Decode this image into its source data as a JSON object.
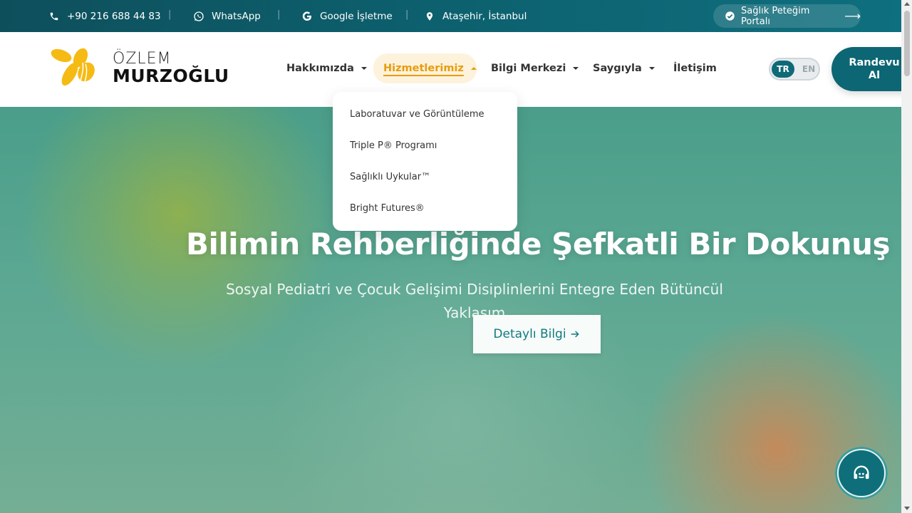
{
  "topbar": {
    "phone": "+90 216 688 44 83",
    "whatsapp": "WhatsApp",
    "google": "Google İşletme",
    "location": "Ataşehir, İstanbul",
    "separator": "|",
    "portal": "Sağlık Peteğim Portalı",
    "portal_arrow": "⟶"
  },
  "logo": {
    "line1": "ÖZLEM",
    "line2": "MURZOĞLU"
  },
  "nav": {
    "items": [
      {
        "label": "Hakkımızda"
      },
      {
        "label": "Hizmetlerimiz"
      },
      {
        "label": "Bilgi Merkezi"
      },
      {
        "label": "Saygıyla"
      },
      {
        "label": "İletişim"
      }
    ],
    "active_index": 1
  },
  "dropdown": {
    "items": [
      {
        "label": "Laboratuvar ve Görüntüleme"
      },
      {
        "label": "Triple P® Programı"
      },
      {
        "label": "Sağlıklı Uykular™"
      },
      {
        "label": "Bright Futures®"
      }
    ]
  },
  "lang": {
    "tr": "TR",
    "en": "EN",
    "selected": "TR"
  },
  "cta": {
    "line1": "Randevu",
    "line2": "Al"
  },
  "hero": {
    "title": "Bilimin Rehberliğinde Şefkatli Bir Dokunuş",
    "subtitle": "Sosyal Pediatri ve Çocuk Gelişimi Disiplinlerini Entegre Eden Bütüncül Yaklaşım",
    "button": "Detaylı Bilgi"
  },
  "colors": {
    "primary": "#0d6673",
    "accent": "#e89c0c",
    "logo_yellow": "#f5bb14"
  },
  "icons": {
    "phone": "phone-icon",
    "whatsapp": "whatsapp-icon",
    "google": "google-icon",
    "location": "location-pin-icon",
    "check": "check-circle-icon",
    "support": "headset-icon"
  }
}
